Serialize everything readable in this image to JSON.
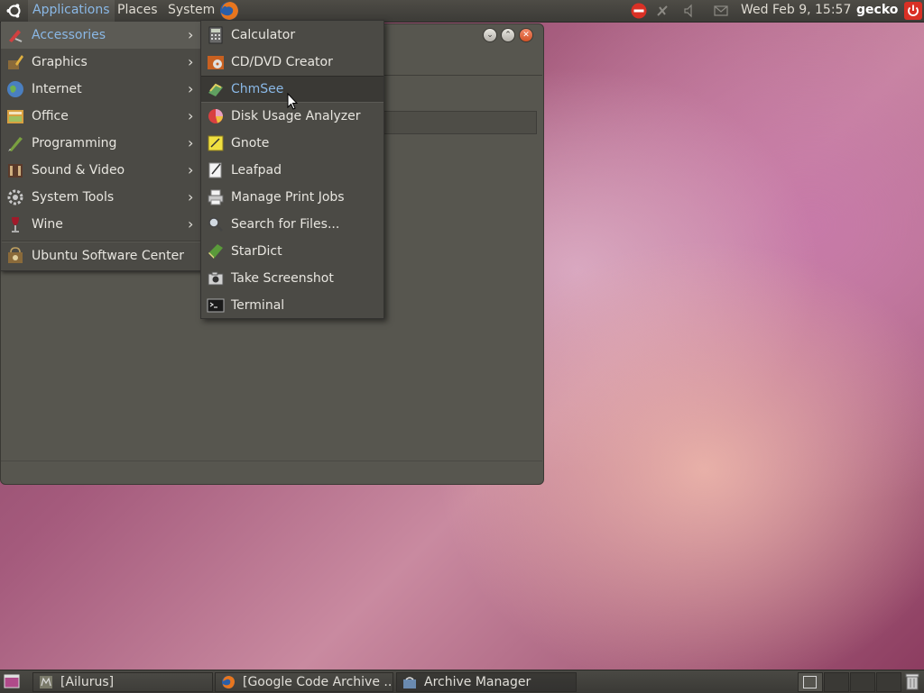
{
  "top_panel": {
    "menus": [
      "Applications",
      "Places",
      "System"
    ],
    "clock": "Wed Feb  9, 15:57",
    "user": "gecko"
  },
  "applications_menu": {
    "items": [
      {
        "label": "Accessories",
        "icon": "accessories-icon",
        "submenu": true
      },
      {
        "label": "Graphics",
        "icon": "graphics-icon",
        "submenu": true
      },
      {
        "label": "Internet",
        "icon": "internet-icon",
        "submenu": true
      },
      {
        "label": "Office",
        "icon": "office-icon",
        "submenu": true
      },
      {
        "label": "Programming",
        "icon": "programming-icon",
        "submenu": true
      },
      {
        "label": "Sound & Video",
        "icon": "sound-video-icon",
        "submenu": true
      },
      {
        "label": "System Tools",
        "icon": "system-tools-icon",
        "submenu": true
      },
      {
        "label": "Wine",
        "icon": "wine-icon",
        "submenu": true
      }
    ],
    "software_center": "Ubuntu Software Center"
  },
  "accessories_submenu": {
    "items": [
      {
        "label": "Calculator",
        "icon": "calculator-icon"
      },
      {
        "label": "CD/DVD Creator",
        "icon": "cd-dvd-creator-icon"
      },
      {
        "label": "ChmSee",
        "icon": "chmsee-icon"
      },
      {
        "label": "Disk Usage Analyzer",
        "icon": "disk-usage-icon"
      },
      {
        "label": "Gnote",
        "icon": "gnote-icon"
      },
      {
        "label": "Leafpad",
        "icon": "leafpad-icon"
      },
      {
        "label": "Manage Print Jobs",
        "icon": "printer-icon"
      },
      {
        "label": "Search for Files...",
        "icon": "search-icon"
      },
      {
        "label": "StarDict",
        "icon": "stardict-icon"
      },
      {
        "label": "Take Screenshot",
        "icon": "camera-icon"
      },
      {
        "label": "Terminal",
        "icon": "terminal-icon"
      }
    ]
  },
  "taskbar": {
    "tasks": [
      {
        "label": "[Ailurus]",
        "icon": "ailurus-icon"
      },
      {
        "label": "[Google Code Archive ...",
        "icon": "firefox-icon"
      },
      {
        "label": "Archive Manager",
        "icon": "archive-manager-icon"
      }
    ]
  },
  "colors": {
    "panel": "#3c3b37",
    "menu_bg": "#4b4a45",
    "highlight_text": "#8ab8e6",
    "close_button": "#d35226"
  }
}
